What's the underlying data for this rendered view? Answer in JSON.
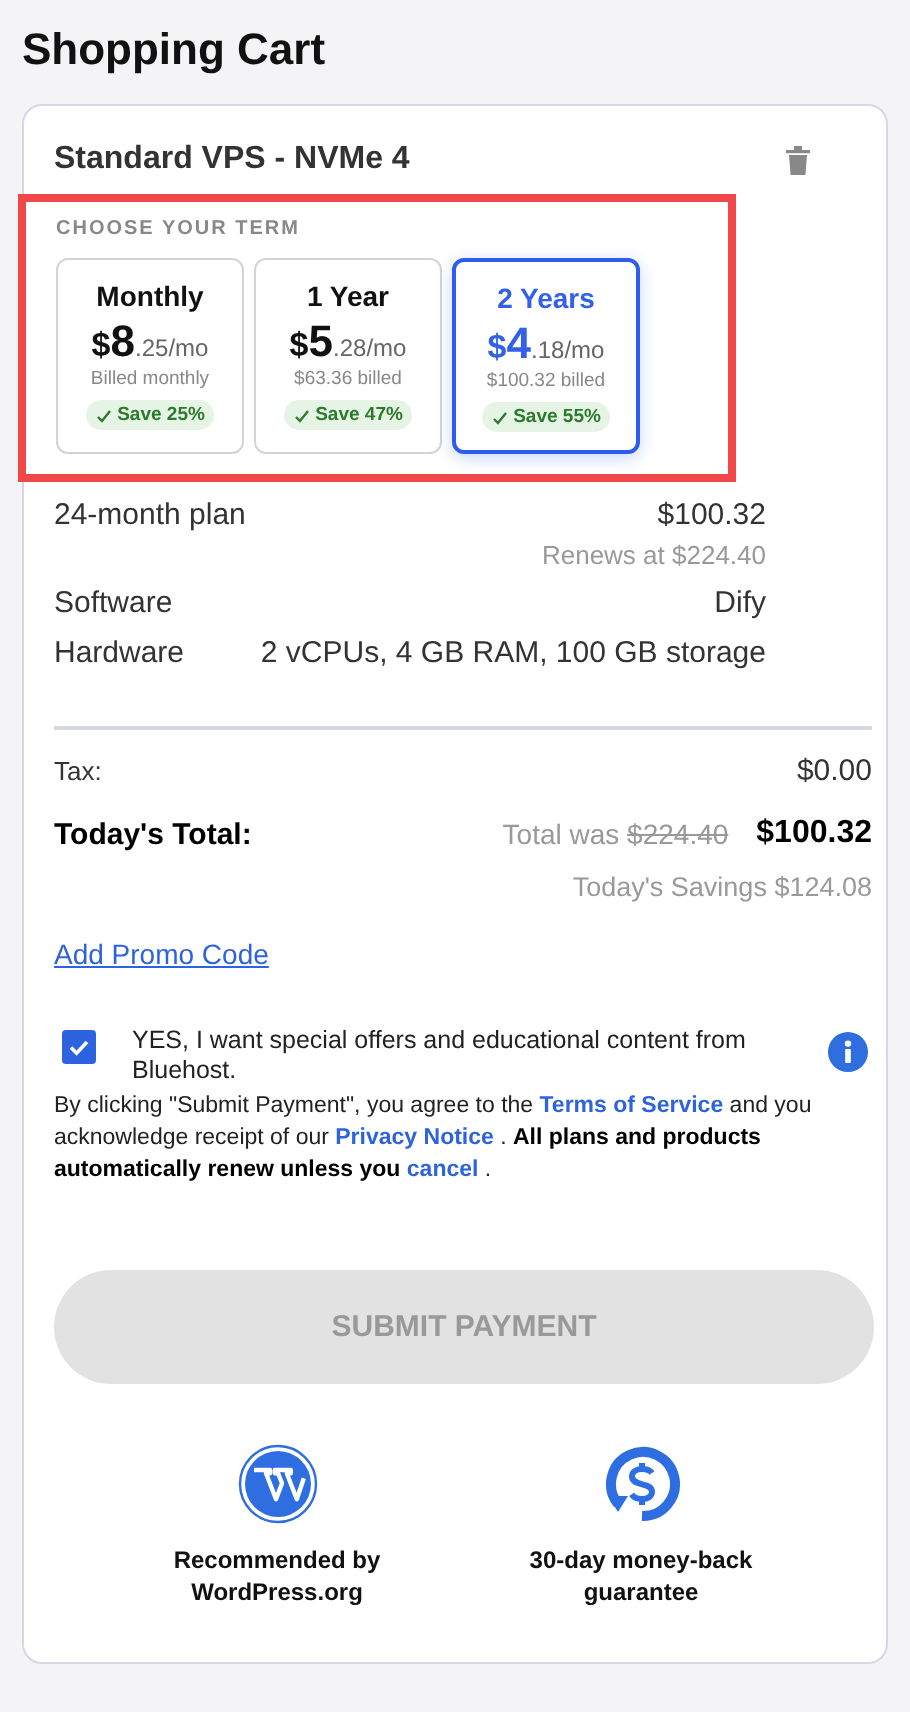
{
  "page_title": "Shopping Cart",
  "cart_item": {
    "name": "Standard VPS - NVMe 4",
    "term_heading": "CHOOSE YOUR TERM",
    "terms": [
      {
        "label": "Monthly",
        "currency": "$",
        "price_whole": "8",
        "price_rest": ".25/mo",
        "billed": "Billed monthly",
        "savings": "Save 25%",
        "selected": false
      },
      {
        "label": "1 Year",
        "currency": "$",
        "price_whole": "5",
        "price_rest": ".28/mo",
        "billed": "$63.36 billed",
        "savings": "Save 47%",
        "selected": false
      },
      {
        "label": "2 Years",
        "currency": "$",
        "price_whole": "4",
        "price_rest": ".18/mo",
        "billed": "$100.32 billed",
        "savings": "Save 55%",
        "selected": true
      }
    ],
    "details": [
      {
        "label": "24-month plan",
        "value": "$100.32",
        "note": "Renews at $224.40"
      },
      {
        "label": "Software",
        "value": "Dify"
      },
      {
        "label": "Hardware",
        "value": "2 vCPUs, 4 GB RAM, 100 GB storage"
      }
    ]
  },
  "tax": {
    "label": "Tax:",
    "value": "$0.00"
  },
  "total": {
    "label": "Today's Total:",
    "was_label": "Total was",
    "was_value": "$224.40",
    "value": "$100.32",
    "savings": "Today's Savings $124.08"
  },
  "promo_link": "Add Promo Code",
  "consent": {
    "checked": true,
    "text": "YES, I want special offers and educational content from Bluehost."
  },
  "legal": [
    {
      "kind": "plain",
      "text": " By clicking \"Submit Payment\", you agree to the "
    },
    {
      "kind": "link",
      "text": "Terms of Service"
    },
    {
      "kind": "plain",
      "text": " and you acknowledge receipt of our "
    },
    {
      "kind": "link",
      "text": "Privacy Notice"
    },
    {
      "kind": "plain",
      "text": " .  "
    },
    {
      "kind": "bold",
      "text": "All plans and products automatically renew unless you "
    },
    {
      "kind": "link",
      "text": "cancel"
    },
    {
      "kind": "plain",
      "text": " ."
    }
  ],
  "submit": {
    "label": "SUBMIT PAYMENT",
    "disabled": true
  },
  "badges": [
    {
      "kind": "wordpress",
      "text": "Recommended by WordPress.org"
    },
    {
      "kind": "money-back",
      "text": "30-day money-back guarantee"
    }
  ]
}
